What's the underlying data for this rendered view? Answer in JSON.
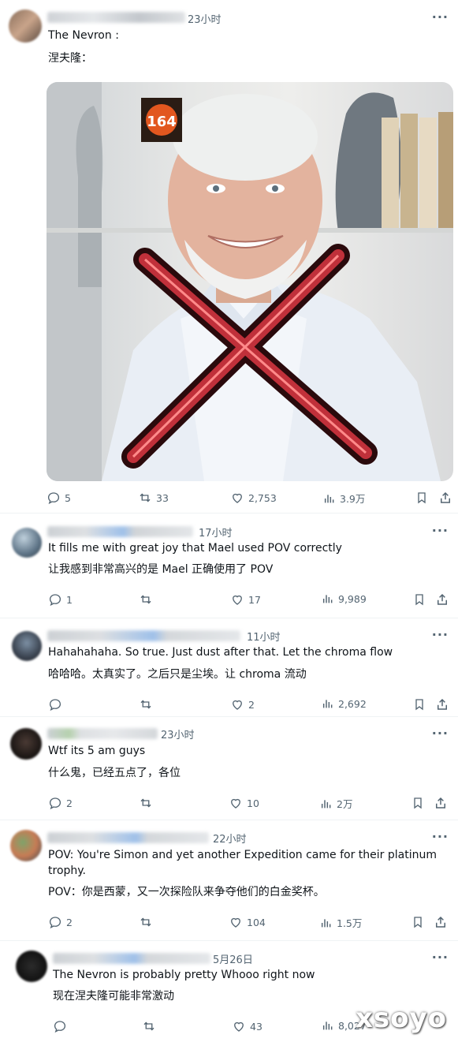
{
  "main_post": {
    "time": "23小时",
    "lines": [
      "The Nevron :",
      "涅夫隆："
    ],
    "media_badge": "164",
    "stats": {
      "replies": "5",
      "reposts": "33",
      "likes": "2,753",
      "views": "3.9万"
    }
  },
  "replies": [
    {
      "time": "17小时",
      "text": "It fills me with great joy that Mael used POV correctly",
      "translation": "让我感到非常高兴的是 Mael 正确使用了 POV",
      "stats": {
        "replies": "1",
        "reposts": "",
        "likes": "17",
        "views": "9,989"
      }
    },
    {
      "time": "11小时",
      "text": "Hahahahaha. So true. Just dust after that. Let the chroma flow",
      "translation": "哈哈哈。太真实了。之后只是尘埃。让 chroma 流动",
      "stats": {
        "replies": "",
        "reposts": "",
        "likes": "2",
        "views": "2,692"
      }
    },
    {
      "time": "23小时",
      "text": "Wtf its 5 am guys",
      "translation": "什么鬼，已经五点了，各位",
      "stats": {
        "replies": "2",
        "reposts": "",
        "likes": "10",
        "views": "2万"
      }
    },
    {
      "time": "22小时",
      "text": "POV: You're Simon and yet another Expedition came for their platinum trophy.",
      "translation": "POV：你是西蒙，又一次探险队来争夺他们的白金奖杯。",
      "stats": {
        "replies": "2",
        "reposts": "",
        "likes": "104",
        "views": "1.5万"
      }
    },
    {
      "time": "5月26日",
      "text": "The Nevron is probably pretty Whooo right now",
      "translation": "现在涅夫隆可能非常激动",
      "stats": {
        "replies": "",
        "reposts": "",
        "likes": "43",
        "views": "8,027"
      }
    }
  ],
  "watermark": "xsoyo",
  "colors": {
    "text": "#0f1419",
    "muted": "#536471",
    "divider": "#eff3f4",
    "x_mark": "#c0303a"
  }
}
